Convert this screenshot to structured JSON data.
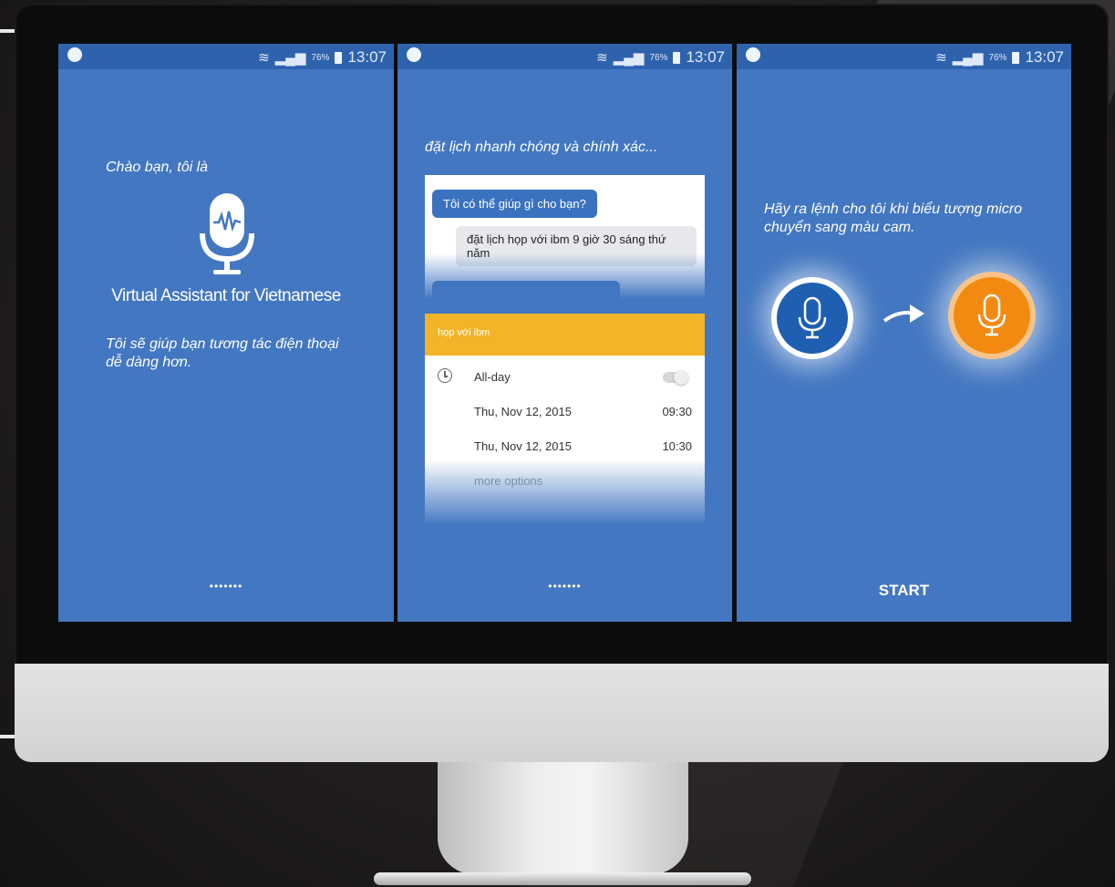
{
  "status_bar": {
    "battery": "76%",
    "time": "13:07"
  },
  "screen1": {
    "greeting": "Chào bạn, tôi là",
    "app_name": "Virtual Assistant for Vietnamese",
    "description": "Tôi sẽ giúp bạn tương tác điện thoại dễ dàng hơn.",
    "page_dots": "•••••••"
  },
  "screen2": {
    "tagline": "đặt lịch nhanh chóng và chính xác...",
    "assistant_question": "Tôi có thể giúp gì cho bạn?",
    "user_reply": "đặt lịch họp với ibm 9 giờ 30 sáng thứ năm",
    "event": {
      "title": "họp với ibm",
      "all_day_label": "All-day",
      "start_date": "Thu, Nov 12, 2015",
      "start_time": "09:30",
      "end_date": "Thu, Nov 12, 2015",
      "end_time": "10:30",
      "more_options": "more options"
    },
    "page_dots": "•••••••"
  },
  "screen3": {
    "instruction": "Hãy ra lệnh cho tôi khi biểu tượng micro chuyển sang màu cam.",
    "start_label": "START"
  },
  "colors": {
    "screen_bg": "#4377c1",
    "status_bar_bg": "#2f62ad",
    "event_header": "#f4b429",
    "mic_idle": "#1f5fb2",
    "mic_active": "#f28a12"
  }
}
